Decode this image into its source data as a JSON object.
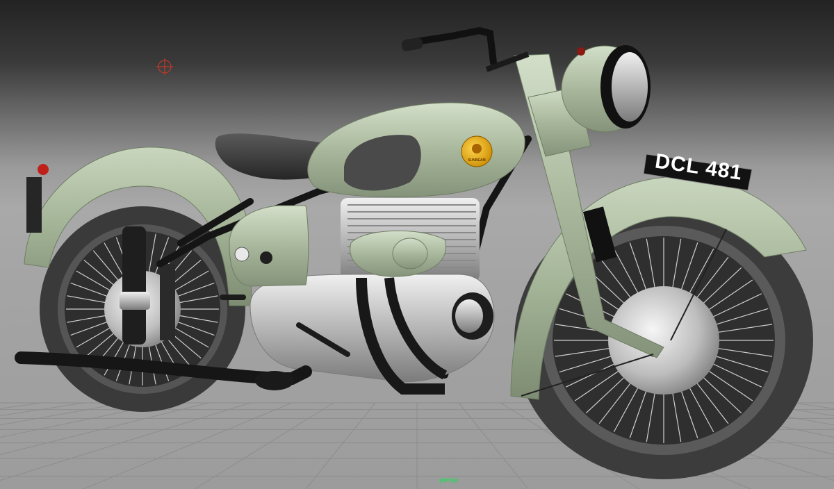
{
  "viewport": {
    "camera_label": "persp",
    "camera_label_color": "#2fd35e",
    "background_top": "#232323",
    "background_horizon": "#a9a9a9",
    "grid_color": "#8a8a8a"
  },
  "model": {
    "license_plate": "DCL 481",
    "tank_badge": "SUNBEAM",
    "body_color": "#a8b89c",
    "tire_color": "#3c3c3c",
    "chrome_color": "#c8c8c8"
  },
  "icons": {
    "locator": "crosshair-icon"
  }
}
